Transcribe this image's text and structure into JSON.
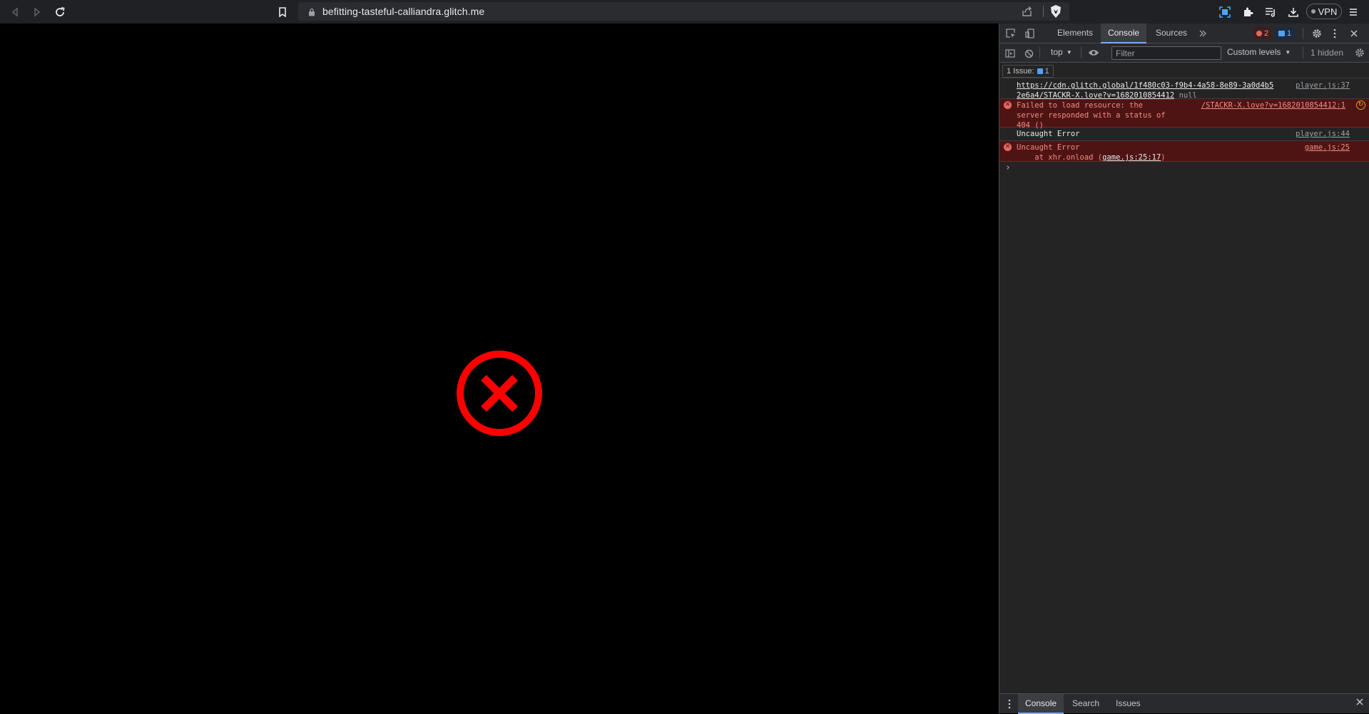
{
  "browser": {
    "url": "befitting-tasteful-calliandra.glitch.me",
    "vpn_label": "VPN"
  },
  "page": {
    "error_icon": "error-circle-x-icon",
    "error_color": "#ff0000"
  },
  "devtools": {
    "tabs": [
      "Elements",
      "Console",
      "Sources"
    ],
    "active_tab": "Console",
    "error_count": "2",
    "issue_count": "1",
    "context": "top",
    "filter_placeholder": "Filter",
    "levels": "Custom levels",
    "hidden": "1 hidden",
    "issues_label": "1 Issue:",
    "issues_count": "1",
    "messages": [
      {
        "line1": "https://cdn.glitch.global/1f480c03-f9b4-4a58-8e89-3a0d4b5",
        "line2": "2e6a4/STACKR-X.love?v=1682010854412",
        "null": "null",
        "source": "player.js:37"
      },
      {
        "text": "Failed to load resource: the\nserver responded with a status of\n404 ()",
        "source": "/STACKR-X.love?v=1682010854412:1"
      },
      {
        "text": "Uncaught Error",
        "source": "player.js:44"
      },
      {
        "text": "Uncaught Error",
        "trace_prefix": "    at xhr.onload (",
        "trace_link": "game.js:25:17",
        "trace_suffix": ")",
        "source": "game.js:25"
      }
    ],
    "drawer_tabs": [
      "Console",
      "Search",
      "Issues"
    ]
  }
}
